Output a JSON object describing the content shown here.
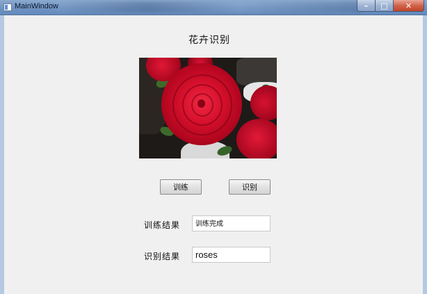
{
  "window": {
    "title": "MainWindow",
    "controls": {
      "minimize": "–",
      "maximize": "□",
      "close": "✕"
    }
  },
  "main": {
    "heading": "花卉识别",
    "image": {
      "subject": "red-roses-photo"
    },
    "buttons": {
      "train": "训练",
      "recognize": "识别"
    },
    "fields": {
      "train_label": "训练结果",
      "train_value": "训练完成",
      "recognize_label": "识别结果",
      "recognize_value": "roses"
    }
  },
  "colors": {
    "titlebar": "#6f93c2",
    "client_bg": "#f0f0f0",
    "close_button": "#c2442a",
    "rose_red": "#c8102e"
  }
}
